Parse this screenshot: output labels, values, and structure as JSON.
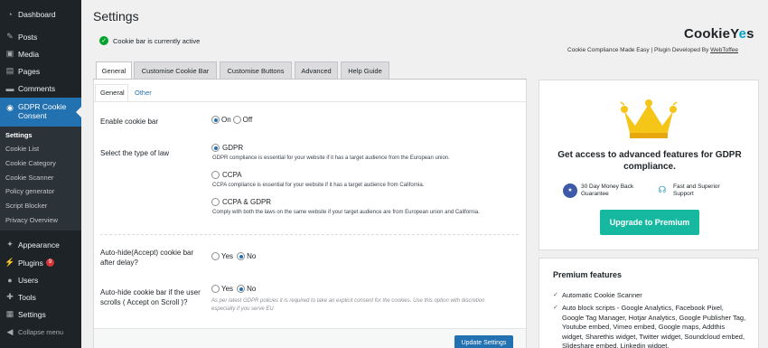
{
  "sidebar": {
    "top_items": [
      {
        "label": "Dashboard",
        "icon": "dashboard-icon"
      },
      {
        "label": "Posts",
        "icon": "pushpin-icon"
      },
      {
        "label": "Media",
        "icon": "media-icon"
      },
      {
        "label": "Pages",
        "icon": "pages-icon"
      },
      {
        "label": "Comments",
        "icon": "comments-icon"
      }
    ],
    "active_item": {
      "label": "GDPR Cookie Consent",
      "icon": "gdpr-icon"
    },
    "submenu": [
      "Settings",
      "Cookie List",
      "Cookie Category",
      "Cookie Scanner",
      "Policy generator",
      "Script Blocker",
      "Privacy Overview"
    ],
    "bottom_items": [
      {
        "label": "Appearance",
        "icon": "appearance-icon"
      },
      {
        "label": "Plugins",
        "icon": "plugins-icon",
        "badge": "9"
      },
      {
        "label": "Users",
        "icon": "users-icon"
      },
      {
        "label": "Tools",
        "icon": "tools-icon"
      },
      {
        "label": "Settings",
        "icon": "settings-icon"
      },
      {
        "label": "Collapse menu",
        "icon": "collapse-icon"
      }
    ]
  },
  "header": {
    "title": "Settings",
    "notice": "Cookie bar is currently active",
    "brand": {
      "logo_prefix": "CookieY",
      "logo_mark": "e",
      "logo_suffix": "s",
      "tagline": "Cookie Compliance Made Easy | Plugin Developed By ",
      "developer": "WebToffee"
    }
  },
  "tabs": [
    "General",
    "Customise Cookie Bar",
    "Customise Buttons",
    "Advanced",
    "Help Guide"
  ],
  "subtabs": [
    "General",
    "Other"
  ],
  "form": {
    "enable_label": "Enable cookie bar",
    "enable_on": "On",
    "enable_off": "Off",
    "law_label": "Select the type of law",
    "laws": [
      {
        "name": "GDPR",
        "desc": "GDPR compliance is essential for your website if it has a target audience from the European union.",
        "checked": true
      },
      {
        "name": "CCPA",
        "desc": "CCPA compliance is essential for your website if it has a target audience from California.",
        "checked": false
      },
      {
        "name": "CCPA & GDPR",
        "desc": "Comply with both the laws on the same website if your target audience are from European union and California.",
        "checked": false
      }
    ],
    "autohide_label": "Auto-hide(Accept) cookie bar after delay?",
    "scroll_label": "Auto-hide cookie bar if the user scrolls ( Accept on Scroll )?",
    "yes": "Yes",
    "no": "No",
    "scroll_help": "As per latest GDPR policies it is required to take an explicit consent for the cookies. Use this option with discretion especially if you serve EU",
    "update_button": "Update Settings"
  },
  "promo": {
    "title": "Get access to advanced features for GDPR compliance.",
    "money_back": "30 Day Money Back Guarantee",
    "support": "Fast and Superior Support",
    "upgrade_button": "Upgrade to Premium",
    "crown_color": "#f5c518"
  },
  "premium": {
    "title": "Premium features",
    "items": [
      "Automatic Cookie Scanner",
      "Auto block scripts - Google Analytics, Facebook Pixel, Google Tag Manager, Hotjar Analytics, Google Publisher Tag, Youtube embed, Vimeo embed, Google maps, Addthis widget, Sharethis widget, Twitter widget, Soundcloud embed, Slideshare embed, Linkedin widget,"
    ]
  }
}
